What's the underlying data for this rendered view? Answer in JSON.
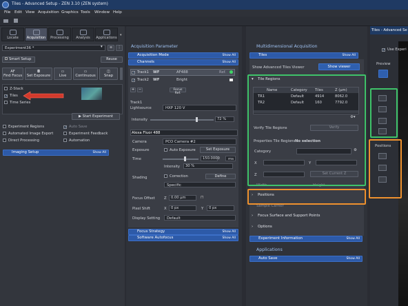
{
  "window": {
    "title": "Tiles - Advanced Setup - ZEN 3.10 (ZEN system)",
    "logo": "zeiss-logo"
  },
  "menu": [
    "File",
    "Edit",
    "View",
    "Acquisition",
    "Graphics",
    "Tools",
    "Window",
    "Help"
  ],
  "tabs": [
    {
      "label": "Locate"
    },
    {
      "label": "Acquisition"
    },
    {
      "label": "Processing"
    },
    {
      "label": "Analysis"
    },
    {
      "label": "Applications"
    }
  ],
  "left": {
    "experiment": "Experiment36 *",
    "smart_setup": "Smart Setup",
    "reuse": "Reuse",
    "actions": [
      "AF",
      "Find Focus",
      "Set Exposure",
      "Live",
      "Continuous",
      "Snap"
    ],
    "options": {
      "zstack": "Z-Stack",
      "tiles": "Tiles",
      "timeseries": "Time Series"
    },
    "start": "Start Experiment",
    "checks": {
      "experiment_regions": "Experiment Regions",
      "auto_save": "Auto Save",
      "automated_image_export": "Automated Image Export",
      "experiment_feedback": "Experiment Feedback",
      "direct_processing": "Direct Processing",
      "automation": "Automation"
    },
    "imaging_setup": "Imaging Setup",
    "show_all": "Show All"
  },
  "mid": {
    "header": "Acquisition Parameter",
    "acq_mode": "Acquisition Mode",
    "channels": "Channels",
    "show_all": "Show All",
    "tracks": [
      {
        "name": "Track1",
        "mode": "WF",
        "dye": "AF488",
        "ref": "Ref."
      },
      {
        "name": "Track2",
        "mode": "WF",
        "dye": "Bright"
      }
    ],
    "focus_ref": "Focus Ref.",
    "track_label": "Track1",
    "lightsource_label": "Lightsource",
    "lightsource": "HXP 120 V",
    "intensity_label": "Intensity",
    "intensity": "72 %",
    "channel_name": "Alexa Fluor 488",
    "camera_label": "Camera",
    "camera": "PCO Camera #2",
    "exposure_label": "Exposure",
    "auto_exposure": "Auto Exposure",
    "set_exposure": "Set Exposure",
    "time_label": "Time",
    "time": "150.0000",
    "time_unit": "ms",
    "intensity2": "30 %",
    "shading_label": "Shading",
    "correction": "Correction",
    "define": "Define",
    "specific": "Specific",
    "focus_offset_label": "Focus Offset",
    "focus_offset_z": "Z",
    "focus_offset": "0.00 µm",
    "pixel_shift_label": "Pixel Shift",
    "px_x": "X",
    "px_x_val": "0 px",
    "px_y": "Y",
    "px_y_val": "0 px",
    "display_setting_label": "Display Setting",
    "display_setting": "Default",
    "focus_strategy": "Focus Strategy",
    "software_autofocus": "Software Autofocus"
  },
  "right": {
    "header": "Multidimensional Acquisition",
    "tiles": "Tiles",
    "show_all": "Show All",
    "show_viewer_label": "Show Advanced Tiles Viewer",
    "show_viewer": "Show viewer",
    "tile_regions": "Tile Regions",
    "columns": [
      "Name",
      "Category",
      "Tiles",
      "Z (µm)"
    ],
    "rows": [
      {
        "name": "TR1",
        "category": "Default",
        "tiles": "4914",
        "z": "8062.0"
      },
      {
        "name": "TR2",
        "category": "Default",
        "tiles": "160",
        "z": "7792.0"
      }
    ],
    "verify_label": "Verify Tile Regions",
    "verify": "Verify",
    "props_label": "Properties Tile Regions:",
    "props_value": "No selection",
    "category": "Category",
    "x": "X",
    "y": "Y",
    "z": "Z",
    "set_current_z": "Set Current Z",
    "positions": "Positions",
    "focus_surface": "Focus Surface and Support Points",
    "options": "Options",
    "experiment_information": "Experiment Information",
    "applications": "Applications",
    "auto_save": "Auto Save"
  },
  "far": {
    "title": "Tiles - Advanced Se",
    "use_exp": "Use Experi",
    "preview": "Preview",
    "positions": "Positions"
  },
  "colors": {
    "highlight_green": "#3fc46a",
    "highlight_orange": "#f0922e",
    "arrow_red": "#d23a2c",
    "accent_blue": "#2d5aa8"
  }
}
